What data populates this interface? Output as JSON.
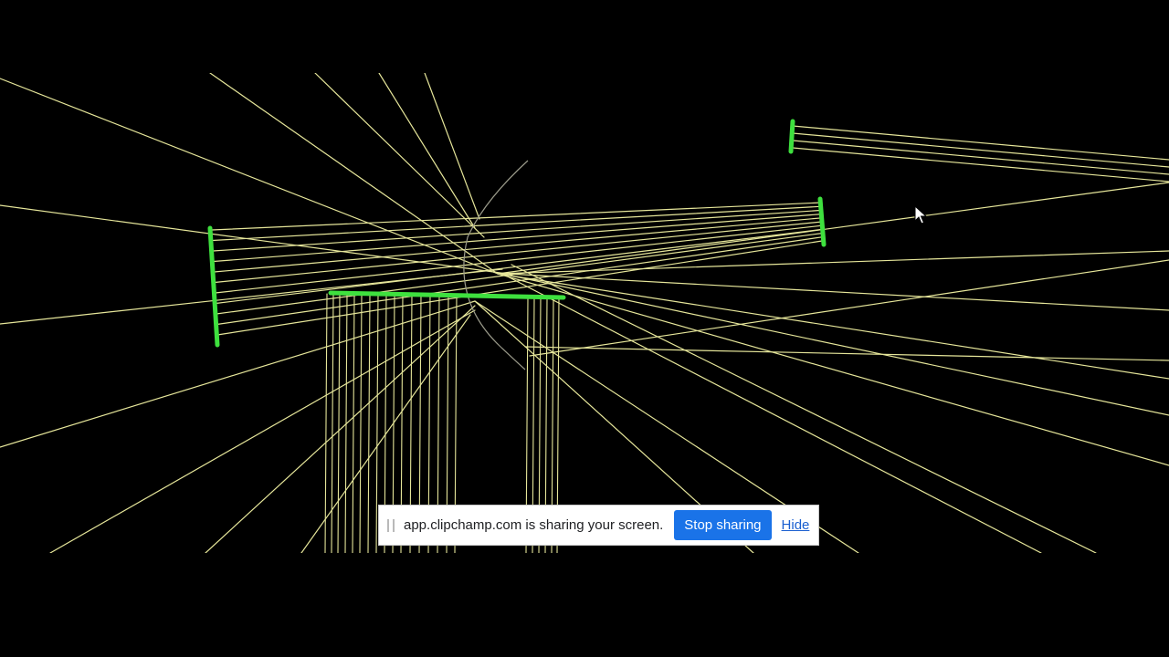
{
  "scene": {
    "background_color": "#000000",
    "ray_color": "#e6e69a",
    "mirror_color": "#3ee03e",
    "lens_curve_color": "#9a9a8a"
  },
  "share_bar": {
    "grip_icon": "drag-handle-icon",
    "message": "app.clipchamp.com is sharing your screen.",
    "stop_label": "Stop sharing",
    "hide_label": "Hide",
    "stop_color": "#1a73e8"
  },
  "pointer": {
    "icon": "mouse-pointer-icon"
  }
}
